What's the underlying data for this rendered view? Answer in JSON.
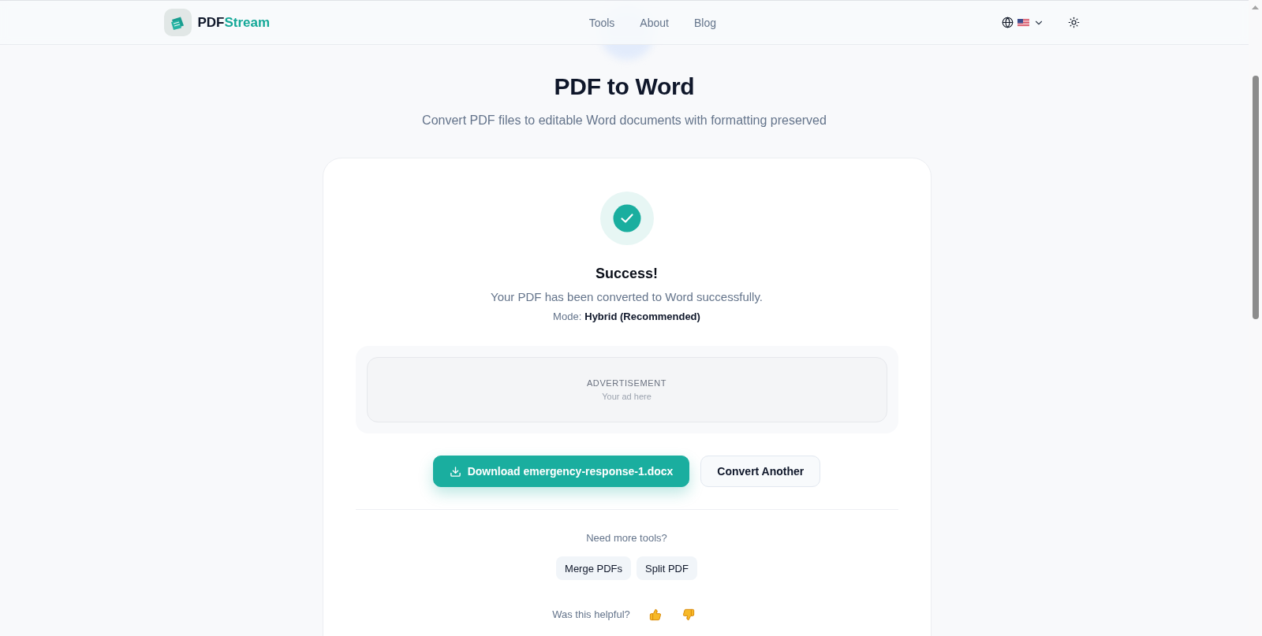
{
  "header": {
    "brand": {
      "name_part_1": "PDF",
      "name_part_2": "Stream"
    },
    "nav": [
      {
        "label": "Tools"
      },
      {
        "label": "About"
      },
      {
        "label": "Blog"
      }
    ]
  },
  "hero": {
    "title": "PDF to Word",
    "subtitle": "Convert PDF files to editable Word documents with formatting preserved"
  },
  "result": {
    "heading": "Success!",
    "message": "Your PDF has been converted to Word successfully.",
    "mode": {
      "label": "Mode:",
      "value": "Hybrid (Recommended)"
    }
  },
  "advertisement": {
    "label": "ADVERTISEMENT",
    "note": "Your ad here"
  },
  "actions": [
    {
      "kind": "primary",
      "label": "Download emergency-response-1.docx"
    },
    {
      "kind": "secondary",
      "label": "Convert Another"
    }
  ],
  "more_tools": {
    "heading": "Need more tools?",
    "links": [
      {
        "label": "Merge PDFs"
      },
      {
        "label": "Split PDF"
      }
    ]
  },
  "feedback": {
    "question": "Was this helpful?"
  }
}
